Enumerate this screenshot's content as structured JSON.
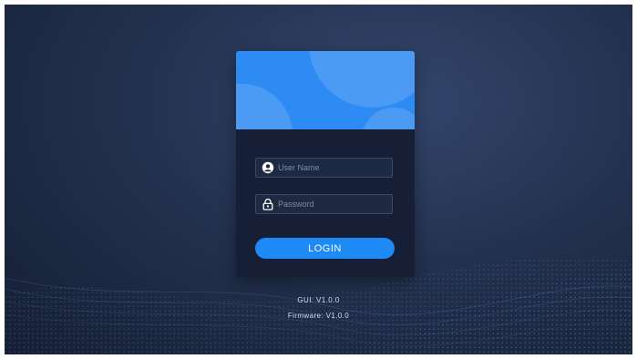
{
  "login": {
    "username_placeholder": "User Name",
    "password_placeholder": "Password",
    "button_label": "LOGIN"
  },
  "footer": {
    "gui_version": "GUI: V1.0.0",
    "firmware_version": "Firmware: V1.0.0"
  },
  "icons": {
    "username": "user-icon",
    "password": "lock-icon"
  },
  "colors": {
    "background": "#23324f",
    "card": "#161f36",
    "banner": "#2e8bf3",
    "button": "#1e8af5"
  }
}
